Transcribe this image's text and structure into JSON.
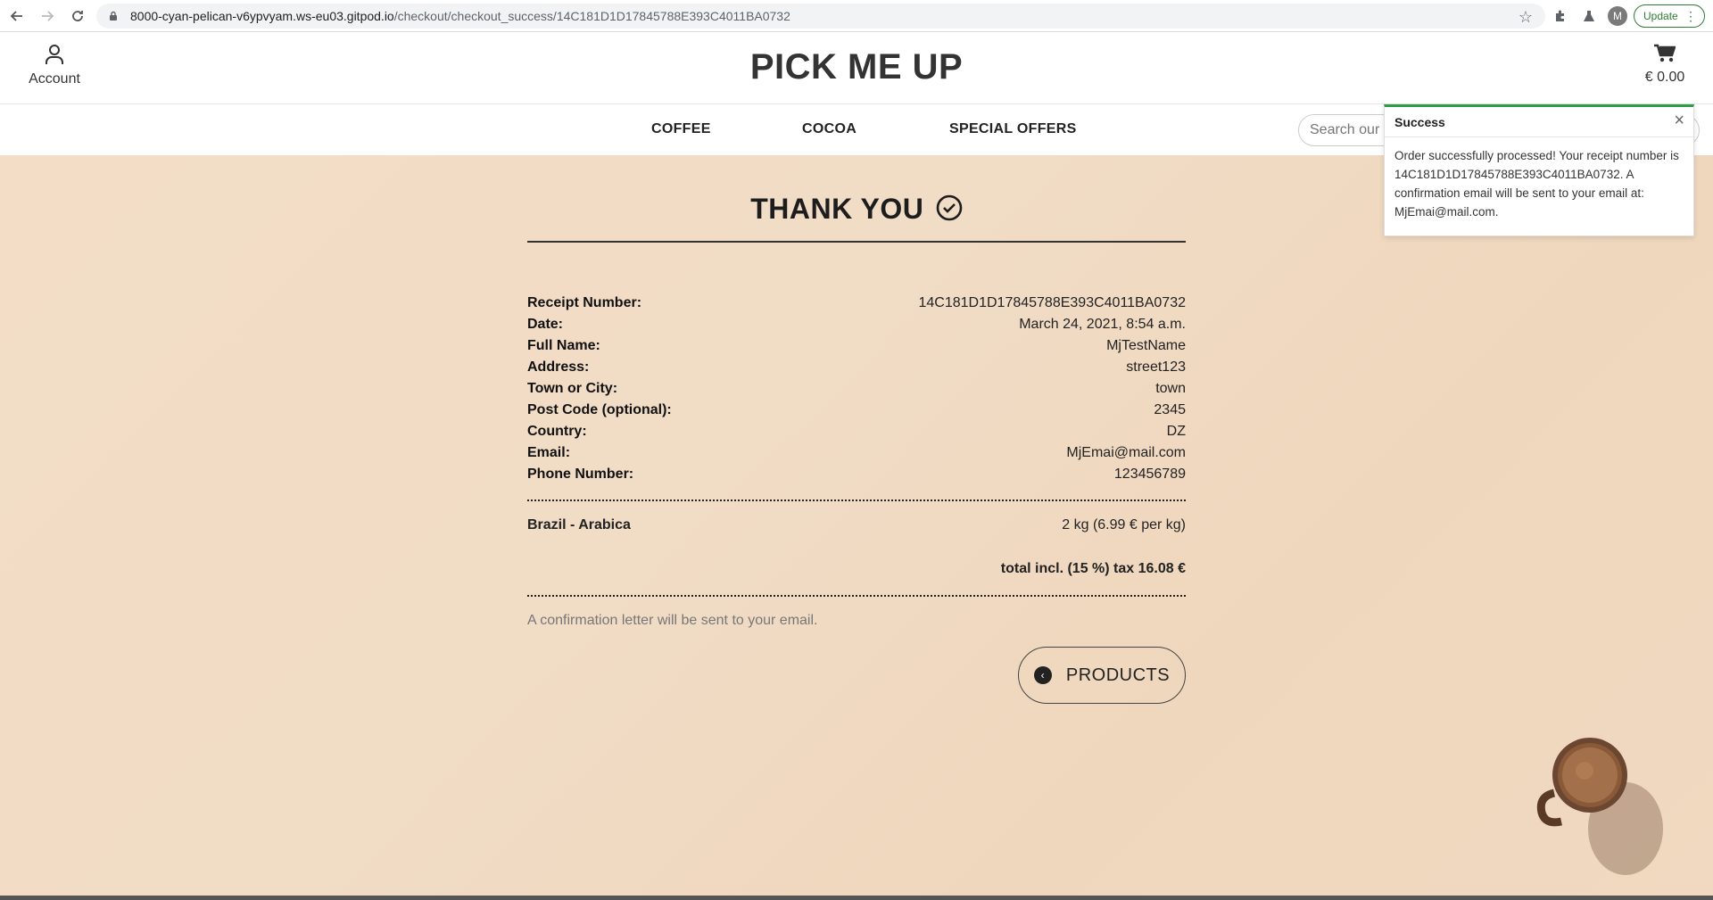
{
  "browser": {
    "url_host": "8000-cyan-pelican-v6ypvyam.ws-eu03.gitpod.io",
    "url_path": "/checkout/checkout_success/14C181D1D17845788E393C4011BA0732",
    "update_label": "Update",
    "profile_initial": "M"
  },
  "header": {
    "account_label": "Account",
    "brand": "PICK ME UP",
    "cart_total": "€ 0.00"
  },
  "nav": {
    "coffee": "COFFEE",
    "cocoa": "COCOA",
    "special_offers": "SPECIAL OFFERS",
    "search_placeholder": "Search our site"
  },
  "receipt": {
    "title": "THANK YOU",
    "details": [
      {
        "label": "Receipt Number:",
        "value": "14C181D1D17845788E393C4011BA0732"
      },
      {
        "label": "Date:",
        "value": "March 24, 2021, 8:54 a.m."
      },
      {
        "label": "Full Name:",
        "value": "MjTestName"
      },
      {
        "label": "Address:",
        "value": "street123"
      },
      {
        "label": "Town or City:",
        "value": "town"
      },
      {
        "label": "Post Code (optional):",
        "value": "2345"
      },
      {
        "label": "Country:",
        "value": "DZ"
      },
      {
        "label": "Email:",
        "value": "MjEmai@mail.com"
      },
      {
        "label": "Phone Number:",
        "value": "123456789"
      }
    ],
    "item_name": "Brazil - Arabica",
    "item_qty": "2 kg (6.99 € per kg)",
    "total": "total incl. (15 %) tax 16.08 €",
    "confirmation_note": "A confirmation letter will be sent to your email.",
    "products_button": "PRODUCTS"
  },
  "toast": {
    "title": "Success",
    "message": "Order successfully processed! Your receipt number is 14C181D1D17845788E393C4011BA0732. A confirmation email will be sent to your email at: MjEmai@mail.com."
  },
  "colors": {
    "toast_accent": "#2e9c45",
    "page_background": "#f1dcc6"
  }
}
